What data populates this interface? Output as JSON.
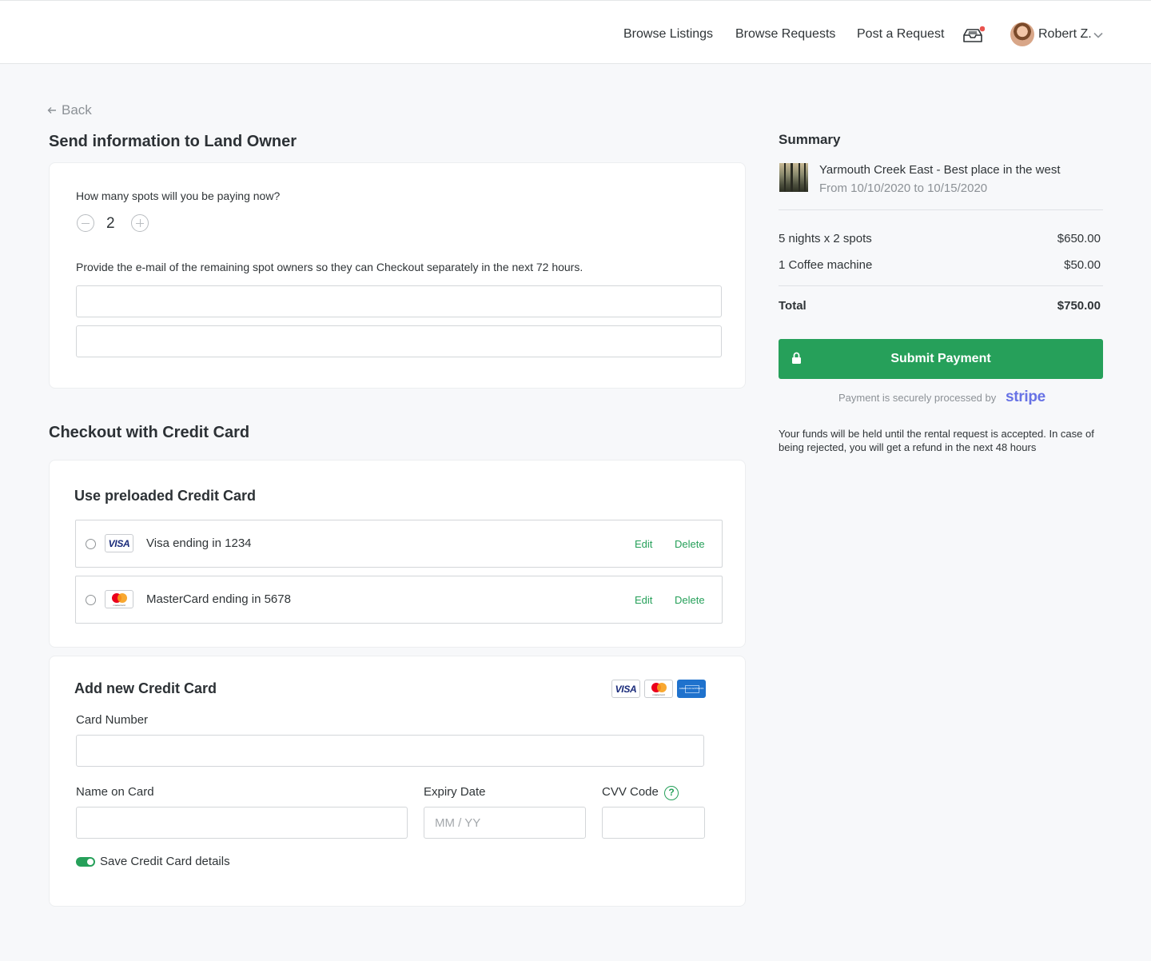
{
  "nav": {
    "browse_listings": "Browse Listings",
    "browse_requests": "Browse Requests",
    "post_request": "Post a Request",
    "user_name": "Robert Z.",
    "inbox_icon": "inbox-icon",
    "notification_color": "#e9534f"
  },
  "back_label": "Back",
  "send_info": {
    "title": "Send information to Land Owner",
    "spots_question": "How many spots will you be paying now?",
    "spots_value": "2",
    "emails_prompt": "Provide the e-mail of the remaining spot owners so they can Checkout separately in the next 72 hours.",
    "email_1": "",
    "email_2": ""
  },
  "checkout": {
    "title": "Checkout with Credit Card",
    "preloaded_title": "Use preloaded Credit Card",
    "cards": [
      {
        "brand": "VISA",
        "name": "Visa ending in 1234",
        "edit": "Edit",
        "delete": "Delete"
      },
      {
        "brand": "mastercard",
        "name": "MasterCard ending in 5678",
        "edit": "Edit",
        "delete": "Delete"
      }
    ],
    "add_new_title": "Add new Credit Card",
    "accepted_brands": [
      "VISA",
      "mastercard",
      "AMERICAN EXPRESS"
    ],
    "card_number_label": "Card Number",
    "card_number_value": "",
    "name_label": "Name on Card",
    "name_value": "",
    "expiry_label": "Expiry Date",
    "expiry_placeholder": "MM / YY",
    "cvv_label": "CVV Code",
    "cvv_help_symbol": "?",
    "cvv_value": "",
    "save_label": "Save Credit Card details",
    "save_enabled": true
  },
  "summary": {
    "title": "Summary",
    "listing_name": "Yarmouth Creek East - Best place in the west",
    "listing_dates": "From 10/10/2020 to 10/15/2020",
    "lines": [
      {
        "label": "5 nights x 2 spots",
        "amount": "$650.00"
      },
      {
        "label": "1 Coffee machine",
        "amount": "$50.00"
      }
    ],
    "total_label": "Total",
    "total_amount": "$750.00",
    "submit_label": "Submit Payment",
    "secure_text": "Payment is securely processed by",
    "processor": "stripe",
    "note": "Your funds will be held until the rental request is accepted. In case of being rejected, you will get a refund in the next 48 hours"
  },
  "colors": {
    "accent": "#26a05a",
    "stripe": "#6772e5",
    "background": "#f7f8fa"
  }
}
